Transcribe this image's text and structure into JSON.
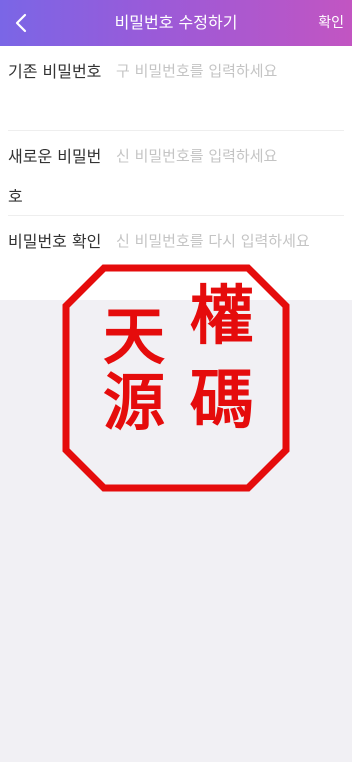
{
  "header": {
    "title": "비밀번호 수정하기",
    "confirm_label": "확인",
    "back_icon": "chevron-left-icon",
    "gradient_colors": [
      "#7a66e6",
      "#c255c2"
    ]
  },
  "form": {
    "fields": [
      {
        "label": "기존 비밀번호",
        "placeholder": "구 비밀번호를 입력하세요"
      },
      {
        "label": "새로운 비밀번호",
        "placeholder": "신 비밀번호를 입력하세요"
      },
      {
        "label": "비밀번호 확인",
        "placeholder": "신 비밀번호를 다시 입력하세요"
      }
    ]
  },
  "watermark": {
    "chars": [
      "權",
      "碼",
      "天",
      "源"
    ],
    "color": "#e50c0c"
  }
}
